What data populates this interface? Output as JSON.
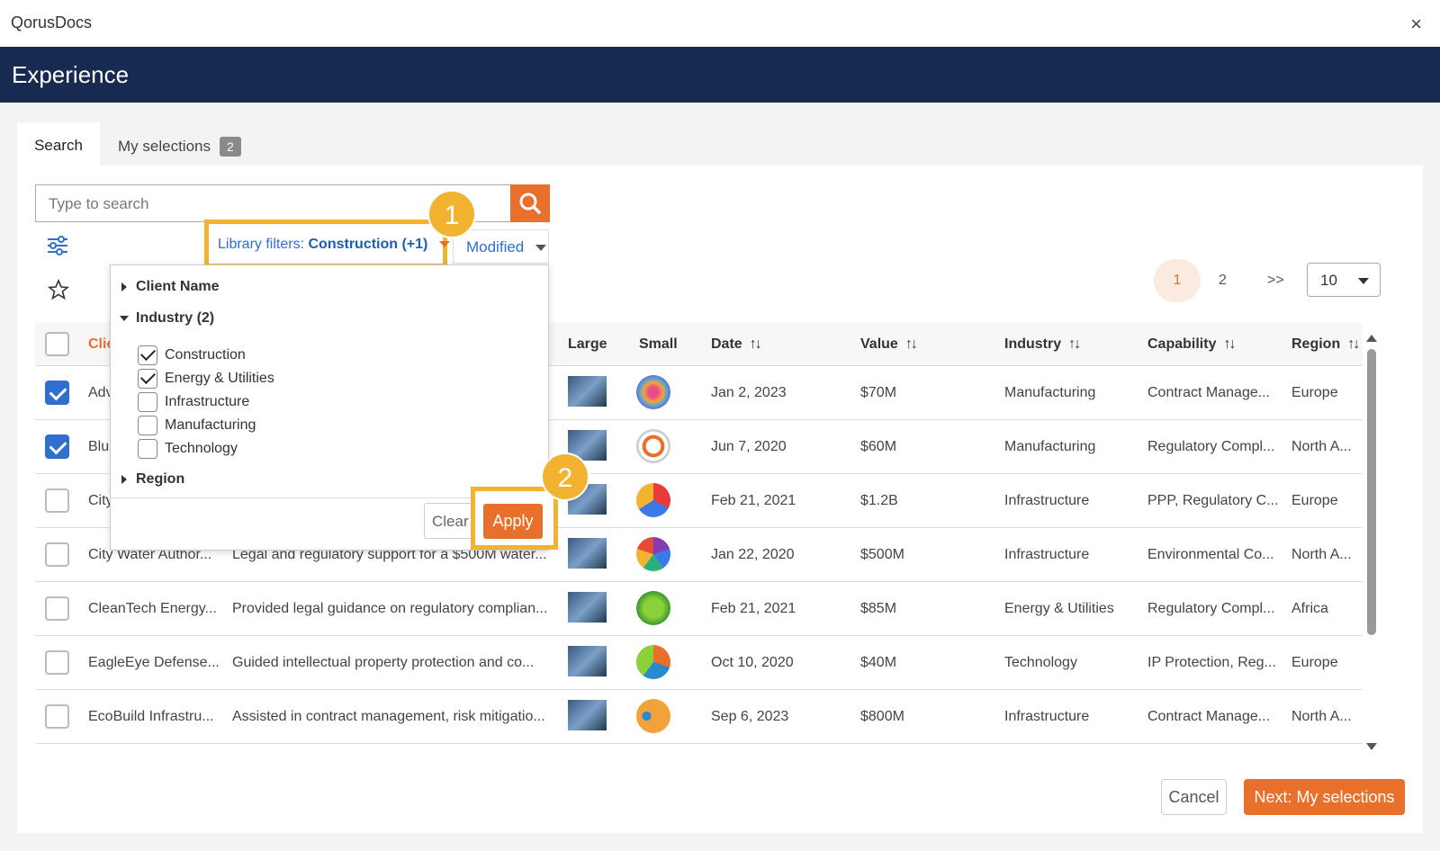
{
  "app": {
    "title": "QorusDocs",
    "close": "×"
  },
  "header": {
    "title": "Experience"
  },
  "tabs": [
    {
      "label": "Search"
    },
    {
      "label": "My selections",
      "badge": "2"
    }
  ],
  "search": {
    "placeholder": "Type to search"
  },
  "filters": {
    "library_label": "Library filters:",
    "library_value": "Construction (+1)",
    "sort_label": "Modified"
  },
  "markers": [
    "1",
    "2"
  ],
  "pager": {
    "pages": [
      "1",
      "2",
      ">>"
    ],
    "active": "1",
    "per_page": "10"
  },
  "table": {
    "columns": [
      "Clie",
      "Large",
      "Small",
      "Date",
      "Value",
      "Industry",
      "Capability",
      "Region"
    ],
    "sortable_marker": "↑↓",
    "rows": [
      {
        "checked": true,
        "client": "Adv",
        "description": "",
        "date": "Jan 2, 2023",
        "value": "$70M",
        "industry": "Manufacturing",
        "capability": "Contract Manage...",
        "region": "Europe"
      },
      {
        "checked": true,
        "client": "Blu",
        "description": "",
        "date": "Jun 7, 2020",
        "value": "$60M",
        "industry": "Manufacturing",
        "capability": "Regulatory Compl...",
        "region": "North A..."
      },
      {
        "checked": false,
        "client": "City",
        "description": "",
        "date": "Feb 21, 2021",
        "value": "$1.2B",
        "industry": "Infrastructure",
        "capability": "PPP, Regulatory C...",
        "region": "Europe"
      },
      {
        "checked": false,
        "client": "City Water Author...",
        "description": "Legal and regulatory support for a $500M water...",
        "date": "Jan 22, 2020",
        "value": "$500M",
        "industry": "Infrastructure",
        "capability": "Environmental Co...",
        "region": "North A..."
      },
      {
        "checked": false,
        "client": "CleanTech Energy...",
        "description": "Provided legal guidance on regulatory complian...",
        "date": "Feb 21, 2021",
        "value": "$85M",
        "industry": "Energy & Utilities",
        "capability": "Regulatory Compl...",
        "region": "Africa"
      },
      {
        "checked": false,
        "client": "EagleEye Defense...",
        "description": "Guided intellectual property protection and co...",
        "date": "Oct 10, 2020",
        "value": "$40M",
        "industry": "Technology",
        "capability": "IP Protection, Reg...",
        "region": "Europe"
      },
      {
        "checked": false,
        "client": "EcoBuild Infrastru...",
        "description": "Assisted in contract management, risk mitigatio...",
        "date": "Sep 6, 2023",
        "value": "$800M",
        "industry": "Infrastructure",
        "capability": "Contract Manage...",
        "region": "North A..."
      }
    ]
  },
  "dropdown": {
    "client_name": "Client Name",
    "industry": "Industry (2)",
    "options": [
      {
        "label": "Construction",
        "checked": true
      },
      {
        "label": "Energy & Utilities",
        "checked": true
      },
      {
        "label": "Infrastructure",
        "checked": false
      },
      {
        "label": "Manufacturing",
        "checked": false
      },
      {
        "label": "Technology",
        "checked": false
      }
    ],
    "region": "Region",
    "clear": "Clear",
    "apply": "Apply"
  },
  "footer": {
    "cancel": "Cancel",
    "next": "Next: My selections"
  },
  "colors": {
    "accent": "#e8702a",
    "navy": "#172a4f",
    "link": "#2f6fd0",
    "highlight": "#f2b430"
  }
}
